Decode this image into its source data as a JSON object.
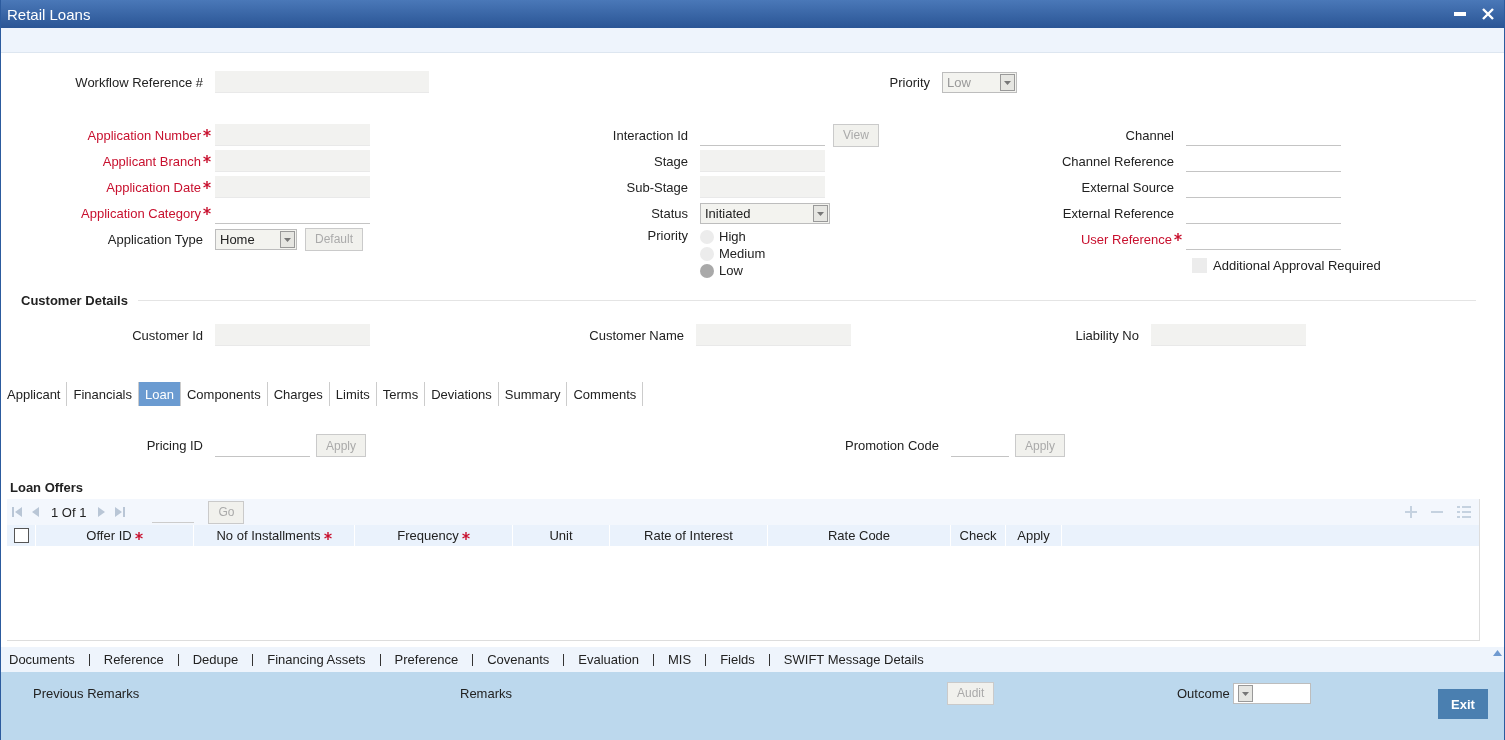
{
  "window": {
    "title": "Retail Loans"
  },
  "workflow": {
    "label": "Workflow Reference #",
    "disabled": true
  },
  "header_priority": {
    "label": "Priority",
    "value": "Low",
    "disabled": true
  },
  "application_fields": [
    {
      "kind": "text",
      "label": "Application Number",
      "required": true,
      "disabled": true
    },
    {
      "kind": "text",
      "label": "Applicant Branch",
      "required": true,
      "disabled": true
    },
    {
      "kind": "text",
      "label": "Application Date",
      "required": true,
      "disabled": true
    },
    {
      "kind": "text",
      "label": "Application Category",
      "required": true,
      "disabled": false
    },
    {
      "kind": "select",
      "label": "Application Type",
      "required": false,
      "value": "Home",
      "button": {
        "label": "Default",
        "disabled": true
      }
    }
  ],
  "process_fields": [
    {
      "kind": "text",
      "label": "Interaction Id",
      "required": false,
      "disabled": false,
      "button": {
        "label": "View",
        "disabled": true
      }
    },
    {
      "kind": "text",
      "label": "Stage",
      "required": false,
      "disabled": true
    },
    {
      "kind": "text",
      "label": "Sub-Stage",
      "required": false,
      "disabled": true
    },
    {
      "kind": "select",
      "label": "Status",
      "required": false,
      "value": "Initiated"
    },
    {
      "kind": "radio",
      "label": "Priority",
      "required": false,
      "options": [
        {
          "label": "High",
          "selected": false
        },
        {
          "label": "Medium",
          "selected": false
        },
        {
          "label": "Low",
          "selected": true
        }
      ]
    }
  ],
  "channel_fields": [
    {
      "kind": "text",
      "label": "Channel",
      "required": false,
      "disabled": false
    },
    {
      "kind": "text",
      "label": "Channel Reference",
      "required": false,
      "disabled": false
    },
    {
      "kind": "text",
      "label": "External Source",
      "required": false,
      "disabled": false
    },
    {
      "kind": "text",
      "label": "External Reference",
      "required": false,
      "disabled": false
    },
    {
      "kind": "text",
      "label": "User Reference",
      "required": true,
      "disabled": false
    },
    {
      "kind": "checkbox",
      "label": "Additional Approval Required",
      "checked": false
    }
  ],
  "customer_details": {
    "title": "Customer Details",
    "fields": [
      {
        "label": "Customer Id",
        "disabled": true
      },
      {
        "label": "Customer Name",
        "disabled": true
      },
      {
        "label": "Liability No",
        "disabled": true
      }
    ]
  },
  "tabs": [
    {
      "label": "Applicant",
      "selected": false
    },
    {
      "label": "Financials",
      "selected": false
    },
    {
      "label": "Loan",
      "selected": true
    },
    {
      "label": "Components",
      "selected": false
    },
    {
      "label": "Charges",
      "selected": false
    },
    {
      "label": "Limits",
      "selected": false
    },
    {
      "label": "Terms",
      "selected": false
    },
    {
      "label": "Deviations",
      "selected": false
    },
    {
      "label": "Summary",
      "selected": false
    },
    {
      "label": "Comments",
      "selected": false
    }
  ],
  "pricing": [
    {
      "label": "Pricing ID",
      "button": {
        "label": "Apply",
        "disabled": true
      }
    },
    {
      "label": "Promotion Code",
      "button": {
        "label": "Apply",
        "disabled": true
      }
    }
  ],
  "loan_offers": {
    "title": "Loan Offers",
    "pager": {
      "position": "1 Of 1",
      "go": {
        "label": "Go",
        "disabled": true
      }
    },
    "select_all": {
      "checked": false
    },
    "columns": [
      {
        "label": "Offer ID",
        "required": true
      },
      {
        "label": "No of Installments",
        "required": true
      },
      {
        "label": "Frequency",
        "required": true
      },
      {
        "label": "Unit",
        "required": false
      },
      {
        "label": "Rate of Interest",
        "required": false
      },
      {
        "label": "Rate Code",
        "required": false
      },
      {
        "label": "Check",
        "required": false
      },
      {
        "label": "Apply",
        "required": false
      }
    ]
  },
  "links": [
    "Documents",
    "Reference",
    "Dedupe",
    "Financing Assets",
    "Preference",
    "Covenants",
    "Evaluation",
    "MIS",
    "Fields",
    "SWIFT Message Details"
  ],
  "footer": {
    "previous_remarks": "Previous Remarks",
    "remarks": "Remarks",
    "audit": {
      "label": "Audit",
      "disabled": true
    },
    "outcome": {
      "label": "Outcome"
    },
    "exit": "Exit"
  }
}
